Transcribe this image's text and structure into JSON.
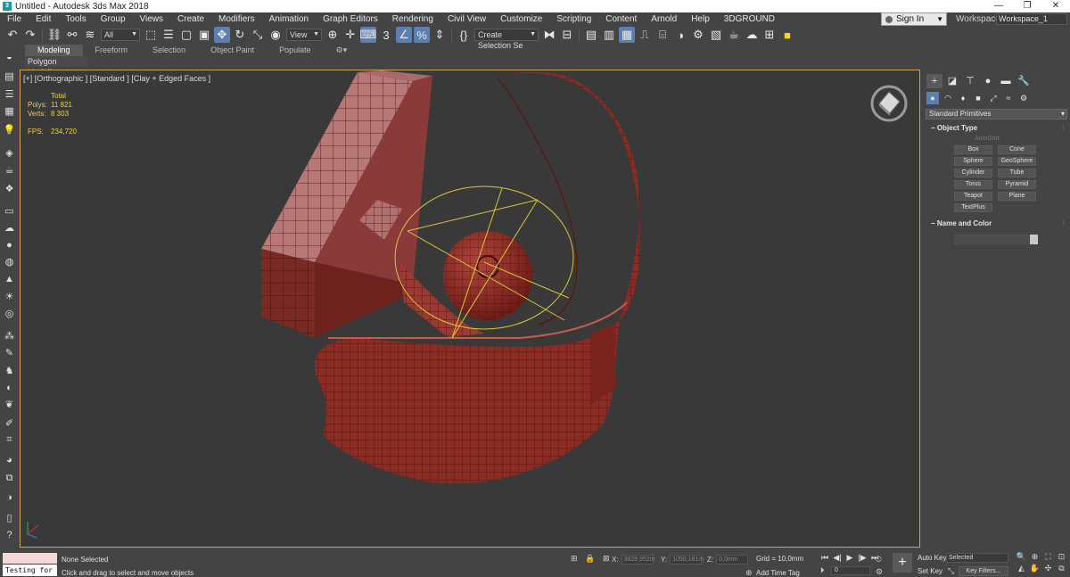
{
  "window": {
    "title": "Untitled - Autodesk 3ds Max 2018",
    "minimize": "—",
    "maximize": "❐",
    "close": "✕"
  },
  "menu": [
    "File",
    "Edit",
    "Tools",
    "Group",
    "Views",
    "Create",
    "Modifiers",
    "Animation",
    "Graph Editors",
    "Rendering",
    "Civil View",
    "Customize",
    "Scripting",
    "Content",
    "Arnold",
    "Help",
    "3DGROUND"
  ],
  "account": {
    "signin": "Sign In",
    "workspaces_label": "Workspaces:",
    "workspace": "Workspace_1"
  },
  "toolbar": {
    "filter": "All",
    "ref_coord": "View",
    "selection_set": "Create Selection Se",
    "snap_value": "3"
  },
  "ribbon": {
    "tabs": [
      "Modeling",
      "Freeform",
      "Selection",
      "Object Paint",
      "Populate"
    ],
    "active_tab": "Modeling",
    "panel": "Polygon Modeling"
  },
  "viewport": {
    "label": "[+] [Orthographic ] [Standard ] [Clay + Edged Faces ]",
    "stats": {
      "header": "Total",
      "polys_label": "Polys:",
      "polys": "11 821",
      "verts_label": "Verts:",
      "verts": "8 303",
      "fps_label": "FPS:",
      "fps": "234,720"
    },
    "model_color": "#8a2a22"
  },
  "command_panel": {
    "category": "Standard Primitives",
    "object_type_title": "Object Type",
    "autogrid": "AutoGrid",
    "primitives": [
      "Box",
      "Cone",
      "Sphere",
      "GeoSphere",
      "Cylinder",
      "Tube",
      "Torus",
      "Pyramid",
      "Teapot",
      "Plane",
      "TextPlus"
    ],
    "name_color_title": "Name and Color"
  },
  "status": {
    "script_input": "Testing for :",
    "selection": "None Selected",
    "prompt": "Click and drag to select and move objects",
    "x_label": "X:",
    "x": "3828,952m",
    "y_label": "Y:",
    "y": "1050,181m",
    "z_label": "Z:",
    "z": "0,0mm",
    "grid": "Grid = 10,0mm",
    "add_time_tag": "Add Time Tag",
    "frame": "0",
    "auto_key": "Auto Key",
    "set_key": "Set Key",
    "key_mode": "Selected",
    "key_filters": "Key Filters..."
  }
}
